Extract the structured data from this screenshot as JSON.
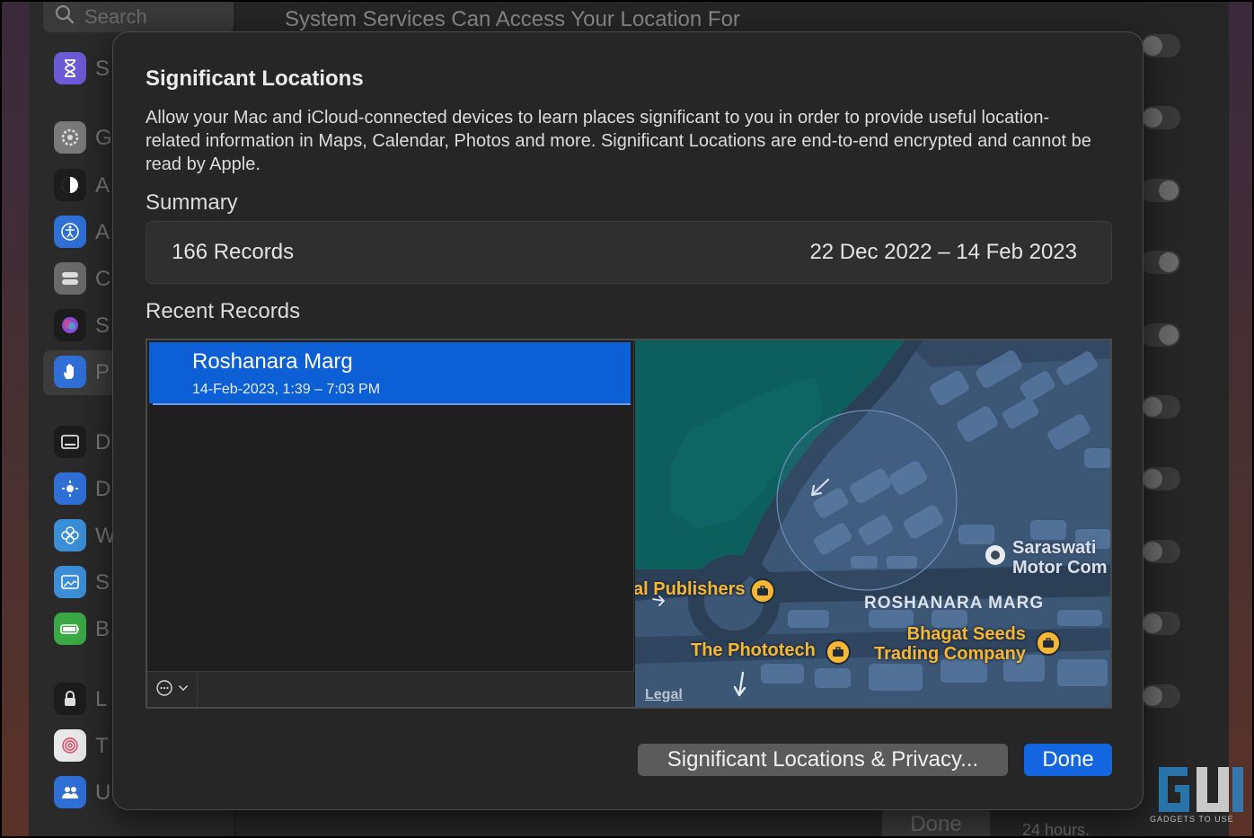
{
  "background": {
    "search_placeholder": "Search",
    "header_text": "System Services Can Access Your Location For",
    "sidebar_letters": [
      "S",
      "G",
      "A",
      "A",
      "C",
      "S",
      "P",
      "D",
      "D",
      "W",
      "S",
      "B",
      "L",
      "T",
      "U"
    ],
    "done_label": "Done",
    "footer_text": "24 hours."
  },
  "dialog": {
    "title": "Significant Locations",
    "description": "Allow your Mac and iCloud-connected devices to learn places significant to you in order to provide useful location-related information in Maps, Calendar, Photos and more. Significant Locations are end-to-end encrypted and cannot be read by Apple.",
    "summary_label": "Summary",
    "summary": {
      "records": "166 Records",
      "date_range": "22 Dec 2022 – 14 Feb 2023"
    },
    "recent_label": "Recent Records",
    "records": [
      {
        "name": "Roshanara Marg",
        "time": "14-Feb-2023, 1:39 – 7:03 PM",
        "selected": true
      }
    ],
    "map": {
      "labels": {
        "publishers": "al Publishers",
        "phototech": "The Phototech",
        "saraswati_line1": "Saraswati",
        "saraswati_line2": "Motor Com",
        "road": "ROSHANARA MARG",
        "bhagat_line1": "Bhagat Seeds",
        "bhagat_line2": "Trading Company",
        "legal": "Legal"
      }
    },
    "buttons": {
      "privacy": "Significant Locations & Privacy...",
      "done": "Done"
    }
  },
  "watermark_text": "GADGETS TO USE",
  "colors": {
    "accent": "#1366e0",
    "selection": "#0d5fd6",
    "poi": "#f7b733",
    "map_park": "#0d5f5e",
    "map_block": "#3c5676",
    "map_building": "#5a7aa4"
  }
}
